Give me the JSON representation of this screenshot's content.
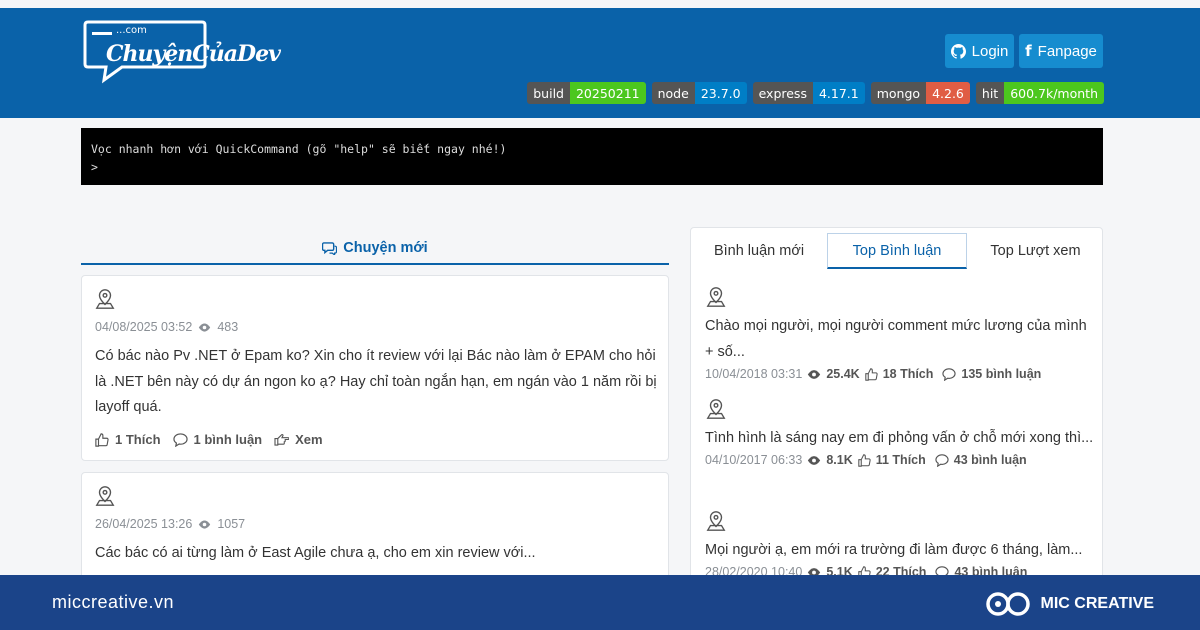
{
  "header": {
    "logo_small": "...com",
    "logo_text": "ChuyệnCủaDev",
    "login_label": "Login",
    "fanpage_label": "Fanpage",
    "badges": [
      {
        "key": "build",
        "value": "20250211",
        "color": "#4cc71e"
      },
      {
        "key": "node",
        "value": "23.7.0",
        "color": "#007ec6"
      },
      {
        "key": "express",
        "value": "4.17.1",
        "color": "#007ec6"
      },
      {
        "key": "mongo",
        "value": "4.2.6",
        "color": "#e05d44"
      },
      {
        "key": "hit",
        "value": "600.7k/month",
        "color": "#4cc71e"
      }
    ]
  },
  "terminal": {
    "line1": "Vọc nhanh hơn với QuickCommand (gõ \"help\" sẽ biết ngay nhé!)",
    "prompt": ">"
  },
  "left": {
    "tab_label": "Chuyện mới",
    "posts": [
      {
        "date": "04/08/2025 03:52",
        "views": "483",
        "text": "Có bác nào Pv .NET ở Epam ko? Xin cho ít review với lại Bác nào làm ở EPAM cho hỏi là .NET bên này có dự án ngon ko ạ? Hay chỉ toàn ngắn hạn, em ngán vào 1 năm rồi bị layoff quá.",
        "likes": "1 Thích",
        "comments": "1 bình luận",
        "view_label": "Xem"
      },
      {
        "date": "26/04/2025 13:26",
        "views": "1057",
        "text": "Các bác có ai từng làm ở East Agile chưa ạ, cho em xin review với..."
      }
    ]
  },
  "right": {
    "tabs": [
      "Bình luận mới",
      "Top Bình luận",
      "Top Lượt xem"
    ],
    "active_tab": 1,
    "items": [
      {
        "text": "Chào mọi người, mọi người comment mức lương của mình + số...",
        "date": "10/04/2018 03:31",
        "views": "25.4K",
        "likes": "18 Thích",
        "comments": "135 bình luận"
      },
      {
        "text": "Tình hình là sáng nay em đi phỏng vấn ở chỗ mới xong thì...",
        "date": "04/10/2017 06:33",
        "views": "8.1K",
        "likes": "11 Thích",
        "comments": "43 bình luận"
      },
      {
        "text": "Mọi người ạ, em mới ra trường đi làm được 6 tháng, làm...",
        "date": "28/02/2020 10:40",
        "views": "5.1K",
        "likes": "22 Thích",
        "comments": "43 bình luận"
      }
    ]
  },
  "footer": {
    "site": "miccreative.vn",
    "brand": "MIC CREATIVE"
  },
  "colors": {
    "header_bg": "#0a62a9",
    "button_bg": "#168ccf",
    "footer_bg": "#1b4489",
    "accent": "#0a62a9"
  }
}
